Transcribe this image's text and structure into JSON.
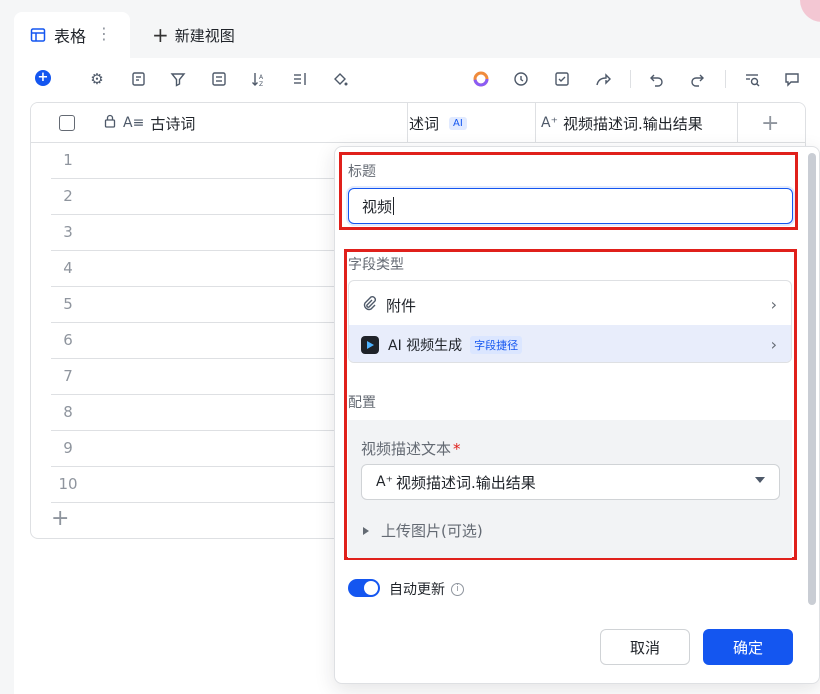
{
  "tabs": {
    "active_label": "表格",
    "new_view_label": "新建视图"
  },
  "toolbar": {
    "icons": [
      "add-icon",
      "settings-icon",
      "field-config-icon",
      "filter-icon",
      "group-icon",
      "sort-icon",
      "row-height-icon",
      "fill-color-icon",
      "ai-icon",
      "history-icon",
      "checklist-icon",
      "share-icon",
      "undo-icon",
      "redo-icon",
      "search-icon",
      "comment-icon"
    ]
  },
  "grid": {
    "columns": [
      {
        "label": "古诗词"
      },
      {
        "label": "述词",
        "badge": "AI"
      },
      {
        "label": "视频描述词.输出结果"
      }
    ],
    "row_numbers": [
      "1",
      "2",
      "3",
      "4",
      "5",
      "6",
      "7",
      "8",
      "9",
      "10"
    ]
  },
  "panel": {
    "title_label": "标题",
    "title_value": "视频",
    "field_type_label": "字段类型",
    "field_types": [
      {
        "label": "附件",
        "icon": "paperclip-icon"
      },
      {
        "label": "AI 视频生成",
        "tag": "字段捷径",
        "icon": "video-ai-icon"
      }
    ],
    "config_label": "配置",
    "video_desc_label": "视频描述文本",
    "required_mark": "*",
    "video_desc_value": "视频描述词.输出结果",
    "upload_label": "上传图片(可选)",
    "auto_update_label": "自动更新",
    "cancel_label": "取消",
    "ok_label": "确定"
  },
  "colors": {
    "accent": "#1456f0",
    "highlight": "#e0201b"
  }
}
